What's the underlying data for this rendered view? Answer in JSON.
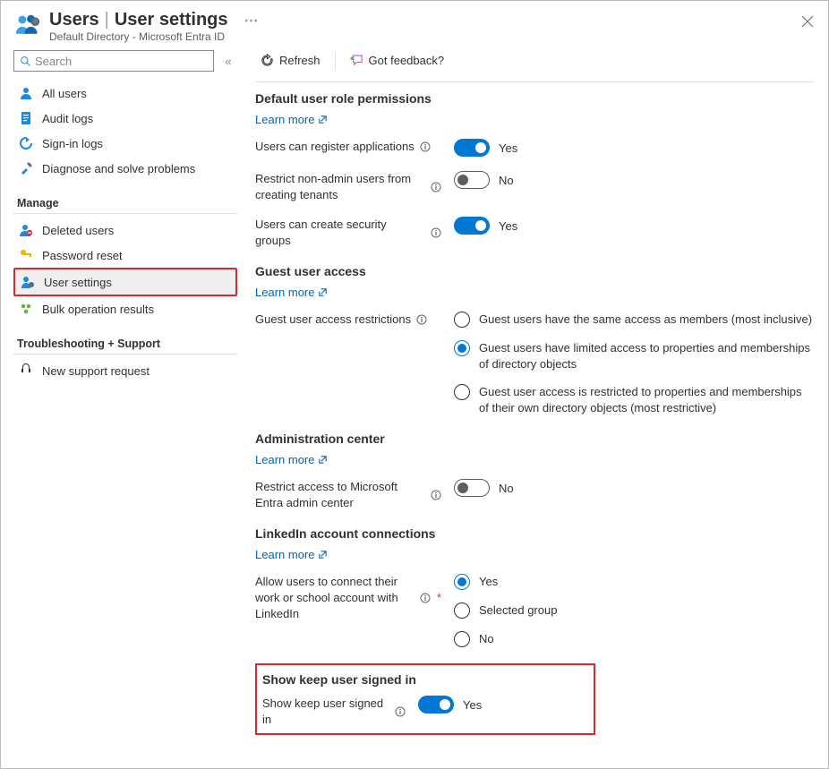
{
  "header": {
    "title_main": "Users",
    "title_sub": "User settings",
    "subtitle": "Default Directory - Microsoft Entra ID"
  },
  "sidebar": {
    "search_placeholder": "Search",
    "items_top": [
      {
        "label": "All users"
      },
      {
        "label": "Audit logs"
      },
      {
        "label": "Sign-in logs"
      },
      {
        "label": "Diagnose and solve problems"
      }
    ],
    "group_manage": "Manage",
    "items_manage": [
      {
        "label": "Deleted users"
      },
      {
        "label": "Password reset"
      },
      {
        "label": "User settings"
      },
      {
        "label": "Bulk operation results"
      }
    ],
    "group_support": "Troubleshooting + Support",
    "items_support": [
      {
        "label": "New support request"
      }
    ]
  },
  "toolbar": {
    "refresh": "Refresh",
    "feedback": "Got feedback?"
  },
  "learn_more": "Learn more",
  "yes": "Yes",
  "no": "No",
  "sections": {
    "default_perms": {
      "title": "Default user role permissions",
      "register_apps": "Users can register applications",
      "restrict_tenants": "Restrict non-admin users from creating tenants",
      "security_groups": "Users can create security groups"
    },
    "guest": {
      "title": "Guest user access",
      "restrictions_label": "Guest user access restrictions",
      "opt1": "Guest users have the same access as members (most inclusive)",
      "opt2": "Guest users have limited access to properties and memberships of directory objects",
      "opt3": "Guest user access is restricted to properties and memberships of their own directory objects (most restrictive)"
    },
    "admin_center": {
      "title": "Administration center",
      "restrict": "Restrict access to Microsoft Entra admin center"
    },
    "linkedin": {
      "title": "LinkedIn account connections",
      "allow": "Allow users to connect their work or school account with LinkedIn",
      "opt_yes": "Yes",
      "opt_group": "Selected group",
      "opt_no": "No"
    },
    "keep": {
      "title": "Show keep user signed in",
      "label": "Show keep user signed in"
    }
  }
}
